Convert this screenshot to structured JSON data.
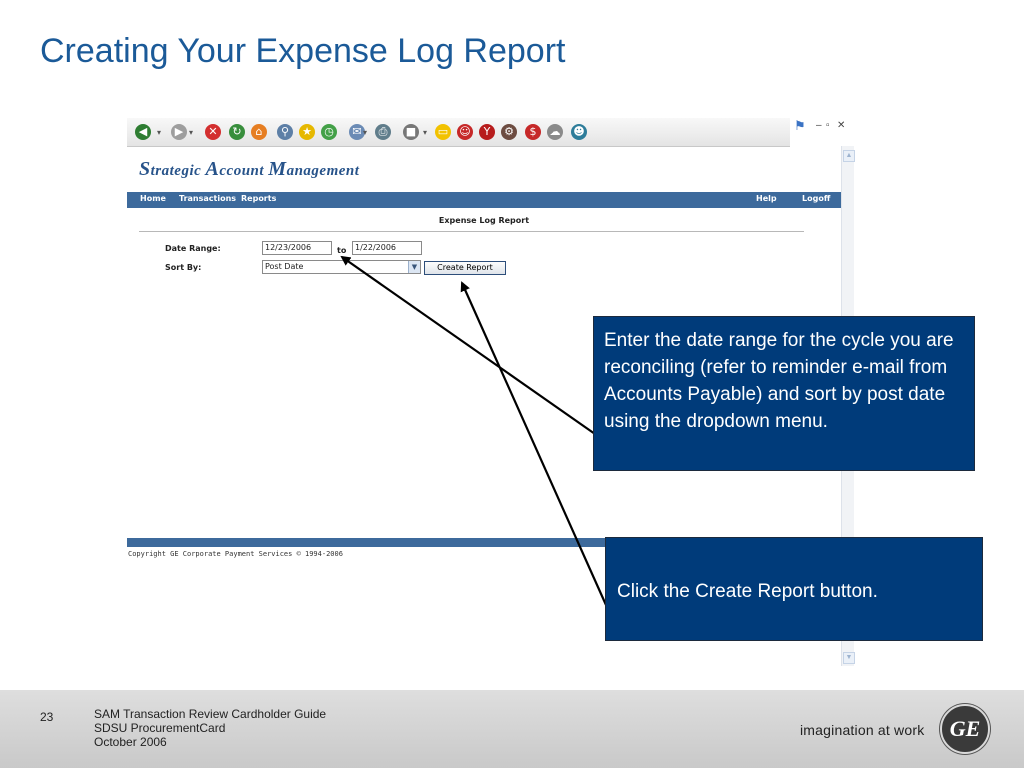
{
  "slide": {
    "title": "Creating Your Expense Log Report"
  },
  "browser": {
    "toolbar_icons": [
      {
        "name": "back-icon",
        "color": "#2e7d32",
        "glyph": "◀"
      },
      {
        "name": "forward-icon",
        "color": "#9e9e9e",
        "glyph": "▶"
      },
      {
        "name": "stop-icon",
        "color": "#d32f2f",
        "glyph": "✕"
      },
      {
        "name": "refresh-icon",
        "color": "#388e3c",
        "glyph": "↻"
      },
      {
        "name": "home-icon",
        "color": "#e67e22",
        "glyph": "⌂"
      },
      {
        "name": "search-icon",
        "color": "#5d7fa6",
        "glyph": "⚲"
      },
      {
        "name": "favorites-icon",
        "color": "#e6b800",
        "glyph": "★"
      },
      {
        "name": "history-icon",
        "color": "#43a047",
        "glyph": "◷"
      },
      {
        "name": "mail-icon",
        "color": "#6b8bb5",
        "glyph": "✉"
      },
      {
        "name": "print-icon",
        "color": "#607d8b",
        "glyph": "⎙"
      },
      {
        "name": "edit-icon",
        "color": "#777777",
        "glyph": "■"
      },
      {
        "name": "notes-icon",
        "color": "#f2c200",
        "glyph": "▭"
      },
      {
        "name": "messenger-icon",
        "color": "#c62828",
        "glyph": "☺"
      },
      {
        "name": "yahoo-icon",
        "color": "#b71c1c",
        "glyph": "Y"
      },
      {
        "name": "tools-icon",
        "color": "#6d4c41",
        "glyph": "⚙"
      },
      {
        "name": "dollar-icon",
        "color": "#c62828",
        "glyph": "$"
      },
      {
        "name": "discuss-icon",
        "color": "#8a8a8a",
        "glyph": "☁"
      },
      {
        "name": "users-icon",
        "color": "#2e7d9a",
        "glyph": "☻"
      }
    ],
    "window_controls": {
      "minimize": "–",
      "restore": "▫",
      "close": "✕"
    }
  },
  "app": {
    "logo": {
      "s": "S",
      "s_rest": "trategic",
      "a": "A",
      "a_rest": "ccount",
      "m": "M",
      "m_rest": "anagement"
    },
    "nav": {
      "home": "Home",
      "transactions": "Transactions",
      "reports": "Reports",
      "help": "Help",
      "logoff": "Logoff"
    },
    "report_title": "Expense Log Report",
    "form": {
      "date_range_label": "Date Range:",
      "date_from": "12/23/2006",
      "to_label": "to",
      "date_to": "1/22/2006",
      "sort_by_label": "Sort By:",
      "sort_selected": "Post Date",
      "create_button": "Create Report"
    },
    "copyright": "Copyright GE Corporate Payment Services © 1994-2006"
  },
  "callouts": {
    "date_range": "Enter the date range for the cycle you are reconciling (refer to reminder e-mail from Accounts Payable) and sort by post date using the dropdown menu.",
    "create_report": "Click the Create Report button."
  },
  "footer": {
    "page_number": "23",
    "line1": "SAM Transaction Review Cardholder Guide",
    "line2": "SDSU ProcurementCard",
    "line3": "October 2006",
    "tagline": "imagination at work",
    "logo_text": "GE"
  },
  "colors": {
    "title": "#1b5a98",
    "callout_bg": "#003b7a",
    "nav_bar": "#3d6a9c"
  }
}
